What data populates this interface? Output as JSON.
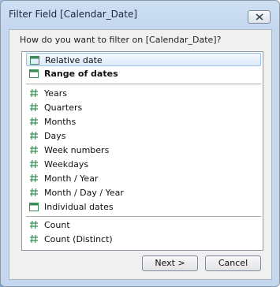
{
  "window": {
    "title": "Filter Field [Calendar_Date]"
  },
  "prompt": "How do you want to filter on [Calendar_Date]?",
  "list": {
    "items": [
      {
        "label": "Relative date",
        "icon": "calendar-icon",
        "selected": true,
        "bold": false
      },
      {
        "label": "Range of dates",
        "icon": "calendar-icon",
        "selected": false,
        "bold": true
      },
      {
        "label": "Years",
        "icon": "hash-icon"
      },
      {
        "label": "Quarters",
        "icon": "hash-icon"
      },
      {
        "label": "Months",
        "icon": "hash-icon"
      },
      {
        "label": "Days",
        "icon": "hash-icon"
      },
      {
        "label": "Week numbers",
        "icon": "hash-icon"
      },
      {
        "label": "Weekdays",
        "icon": "hash-icon"
      },
      {
        "label": "Month / Year",
        "icon": "hash-icon"
      },
      {
        "label": "Month / Day / Year",
        "icon": "hash-icon"
      },
      {
        "label": "Individual dates",
        "icon": "calendar-icon"
      },
      {
        "label": "Count",
        "icon": "hash-icon"
      },
      {
        "label": "Count (Distinct)",
        "icon": "hash-icon"
      }
    ]
  },
  "buttons": {
    "next": "Next >",
    "cancel": "Cancel"
  },
  "colors": {
    "icon": "#3a8c56",
    "selection": "#dceafb",
    "frame": "#c4d7ee"
  }
}
